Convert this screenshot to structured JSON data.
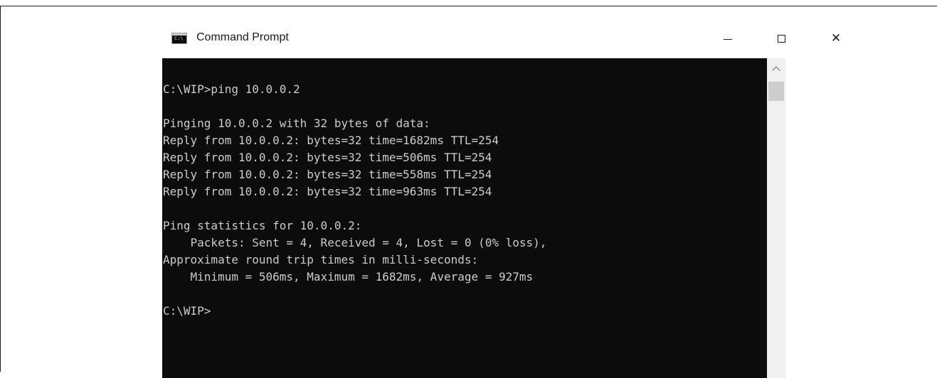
{
  "window": {
    "title": "Command Prompt",
    "icon": "cmd-app-icon",
    "icon_glyph": "C:\\",
    "controls": {
      "minimize_icon": "minimize-icon",
      "maximize_icon": "maximize-icon",
      "close_icon": "close-icon",
      "close_glyph": "✕"
    }
  },
  "console": {
    "lines": [
      "C:\\WIP>ping 10.0.0.2",
      "",
      "Pinging 10.0.0.2 with 32 bytes of data:",
      "Reply from 10.0.0.2: bytes=32 time=1682ms TTL=254",
      "Reply from 10.0.0.2: bytes=32 time=506ms TTL=254",
      "Reply from 10.0.0.2: bytes=32 time=558ms TTL=254",
      "Reply from 10.0.0.2: bytes=32 time=963ms TTL=254",
      "",
      "Ping statistics for 10.0.0.2:",
      "    Packets: Sent = 4, Received = 4, Lost = 0 (0% loss),",
      "Approximate round trip times in milli-seconds:",
      "    Minimum = 506ms, Maximum = 1682ms, Average = 927ms",
      "",
      "C:\\WIP>"
    ]
  },
  "colors": {
    "console_bg": "#0c0c0c",
    "console_text": "#cccccc",
    "scrollbar_track": "#f0f0f0",
    "scrollbar_thumb": "#cdcdcd"
  }
}
